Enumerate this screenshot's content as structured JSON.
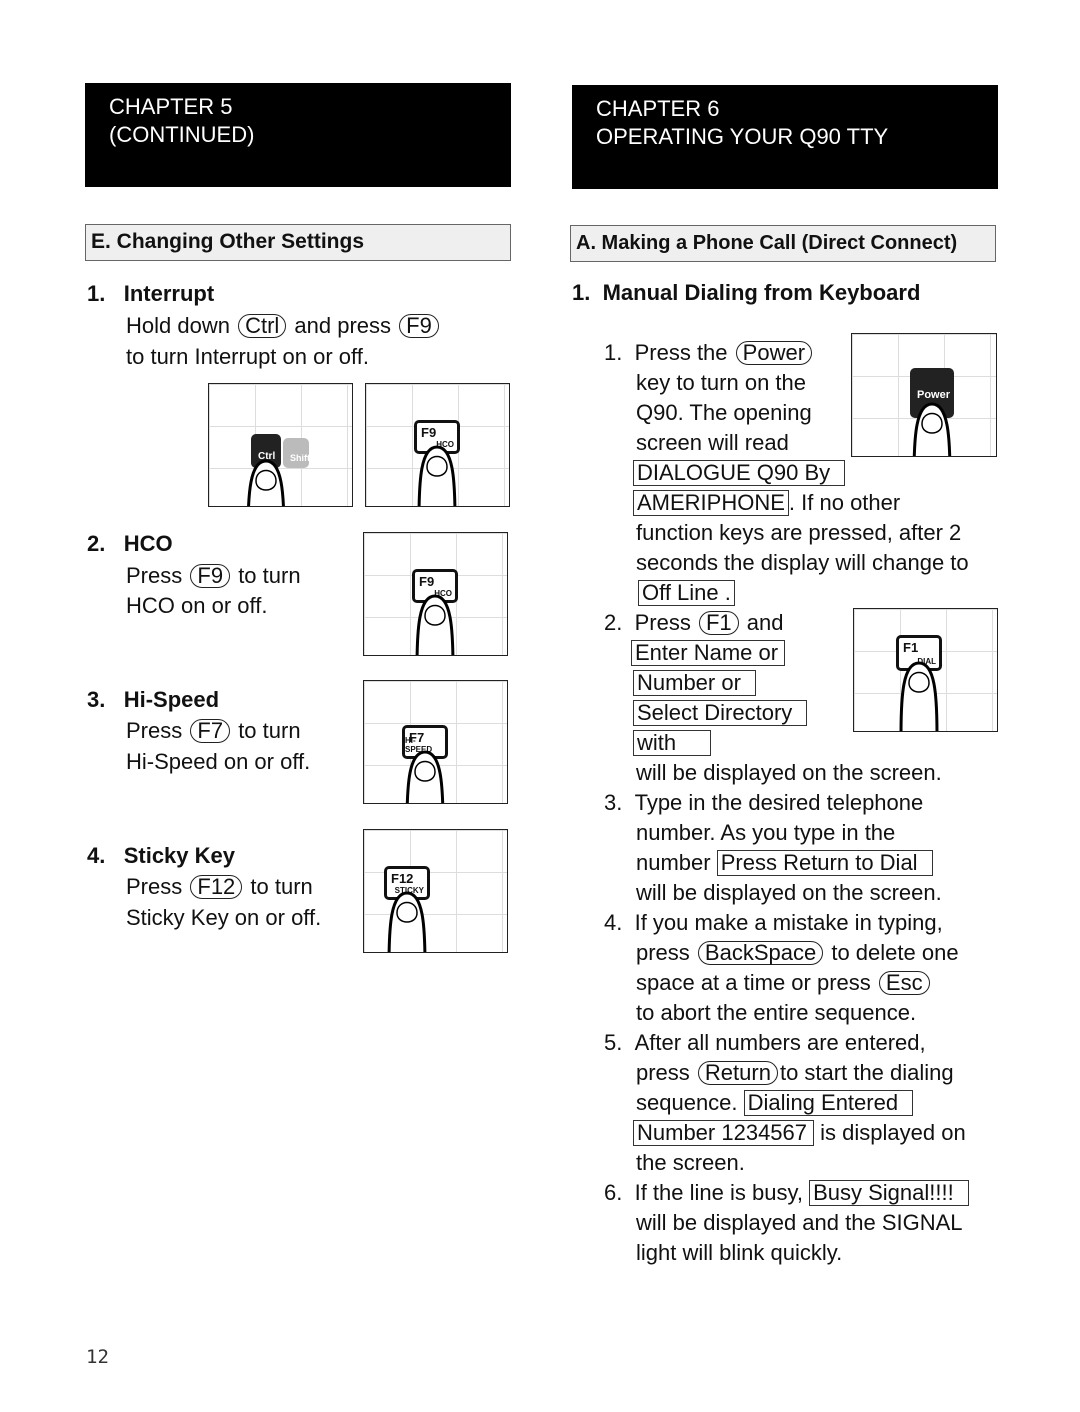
{
  "left": {
    "chapter": {
      "line1": "CHAPTER   5",
      "line2": "(CONTINUED)"
    },
    "section": "E.  Changing Other Settings",
    "items": [
      {
        "num": "1.",
        "title": "Interrupt",
        "pre": "Hold down",
        "key1": "Ctrl",
        "mid": "and press",
        "key2": "F9",
        "line2": "to turn Interrupt on or off."
      },
      {
        "num": "2.",
        "title": "HCO",
        "pre": "Press",
        "key": "F9",
        "post": "to turn",
        "line2": "HCO on or off."
      },
      {
        "num": "3.",
        "title": "Hi-Speed",
        "pre": "Press",
        "key": "F7",
        "post": "to turn",
        "line2": "Hi-Speed on or off."
      },
      {
        "num": "4.",
        "title": "Sticky Key",
        "pre": "Press",
        "key": "F12",
        "post": "to turn",
        "line2": "Sticky Key on or off."
      }
    ],
    "illustrations": [
      {
        "key": "Ctrl",
        "sub": "",
        "side": "Shift"
      },
      {
        "key": "F9",
        "sub": "HCO"
      },
      {
        "key": "F9",
        "sub": "HCO"
      },
      {
        "key": "F7",
        "sub": "HI-SPEED"
      },
      {
        "key": "F12",
        "sub": "STICKY"
      }
    ]
  },
  "right": {
    "chapter": {
      "line1": "CHAPTER  6",
      "line2": "OPERATING YOUR Q90 TTY"
    },
    "section": "A.  Making a Phone Call (Direct Connect)",
    "subhead": {
      "num": "1.",
      "title": "Manual Dialing from Keyboard"
    },
    "illustrations": [
      {
        "key": "Power",
        "sub": ""
      },
      {
        "key": "F1",
        "sub": "DIAL"
      }
    ],
    "steps": {
      "s1": {
        "num": "1.",
        "a": "Press the",
        "key": "Power",
        "b": "key to turn on the",
        "c": "Q90.  The opening",
        "d": "screen will read",
        "disp1": "DIALOGUE Q90 By",
        "disp2": "AMERIPHONE",
        "e": ".  If no other",
        "f": "function keys are pressed, after 2",
        "g": "seconds the display will change to",
        "disp3": "Off Line ."
      },
      "s2": {
        "num": "2.",
        "a": "Press",
        "key": "F1",
        "b": "and",
        "disp1": "Enter Name or",
        "disp2": "Number or",
        "disp3": "Select Directory",
        "disp4": "with",
        "c": "will be displayed on the screen."
      },
      "s3": {
        "num": "3.",
        "a": "Type in the desired telephone",
        "b": "number. As you type in the",
        "c": "number",
        "disp": "Press Return to Dial",
        "d": "will be displayed on the screen."
      },
      "s4": {
        "num": "4.",
        "a": "If you make a mistake in typing,",
        "b": "press",
        "key1": "BackSpace",
        "c": "to delete one",
        "d": "space at a time or press",
        "key2": "Esc",
        "e": "to abort the entire sequence."
      },
      "s5": {
        "num": "5.",
        "a": "After all numbers are entered,",
        "b": "press",
        "key": "Return",
        "c": "to start the dialing",
        "d": "sequence.",
        "disp1": "Dialing Entered",
        "disp2": "Number 1234567",
        "e": "is displayed on",
        "f": "the screen."
      },
      "s6": {
        "num": "6.",
        "a": "If the line is busy,",
        "disp": "Busy Signal!!!!",
        "b": "will be displayed and the SIGNAL",
        "c": "light will blink quickly."
      }
    }
  },
  "page_number": "12"
}
